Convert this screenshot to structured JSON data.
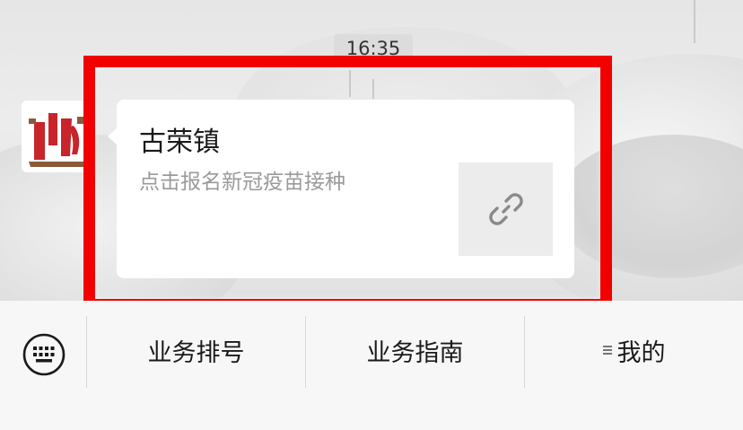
{
  "chat": {
    "timestamp": "16:35"
  },
  "message": {
    "title": "古荣镇",
    "description": "点击报名新冠疫苗接种",
    "thumbnail_icon": "link-icon"
  },
  "menu": {
    "items": [
      {
        "label": "业务排号"
      },
      {
        "label": "业务指南"
      },
      {
        "label": "我的",
        "icon": "menu-lines-icon"
      }
    ]
  },
  "colors": {
    "highlight": "#f20000",
    "logo_red": "#c8242b",
    "logo_brown": "#8a5a3c"
  }
}
